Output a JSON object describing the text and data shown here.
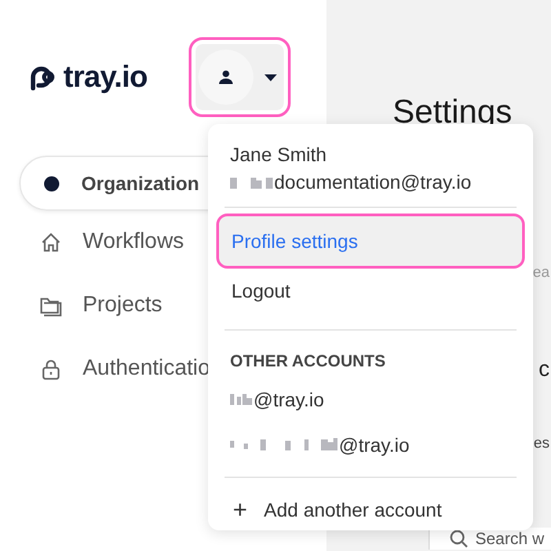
{
  "logo": {
    "text": "tray.io"
  },
  "account_button": {
    "highlighted": true
  },
  "sidebar": {
    "items": [
      {
        "label": "Organization",
        "kind": "pill",
        "selected": true
      },
      {
        "label": "Workflows",
        "kind": "home",
        "selected": false
      },
      {
        "label": "Projects",
        "kind": "folder",
        "selected": false
      },
      {
        "label": "Authenticatio",
        "kind": "lock",
        "selected": false
      }
    ]
  },
  "main": {
    "title": "Settings",
    "fragments": [
      {
        "text": "ea",
        "kind": "muted"
      },
      {
        "text": "c",
        "kind": "heading"
      },
      {
        "text": "es",
        "kind": "label"
      }
    ],
    "search": {
      "placeholder": "Search w"
    }
  },
  "account_menu": {
    "user_name": "Jane Smith",
    "user_email": "documentation@tray.io",
    "items": [
      {
        "label": "Profile settings",
        "highlighted": true
      },
      {
        "label": "Logout",
        "highlighted": false
      }
    ],
    "other_accounts_heading": "OTHER ACCOUNTS",
    "other_accounts": [
      {
        "email": "@tray.io"
      },
      {
        "email": "@tray.io"
      }
    ],
    "add_account": {
      "icon": "+",
      "label": "Add another account"
    }
  }
}
